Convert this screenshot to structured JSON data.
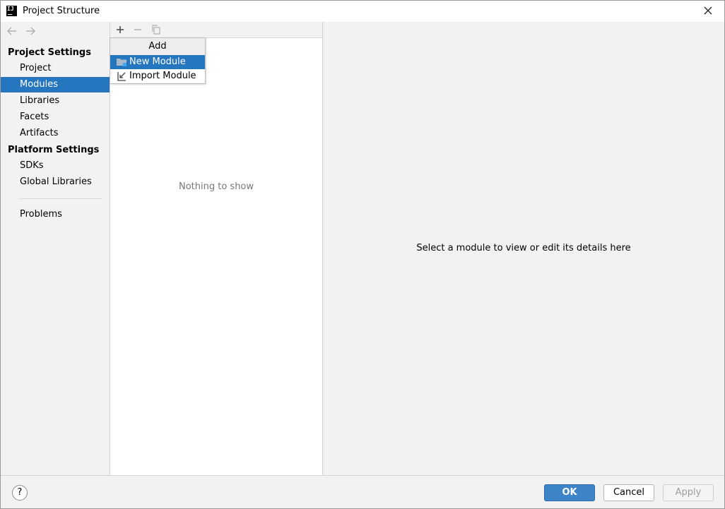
{
  "window": {
    "title": "Project Structure",
    "logo_text": "IJ"
  },
  "sidebar": {
    "project_settings_heading": "Project Settings",
    "project_items": [
      {
        "label": "Project",
        "selected": false
      },
      {
        "label": "Modules",
        "selected": true
      },
      {
        "label": "Libraries",
        "selected": false
      },
      {
        "label": "Facets",
        "selected": false
      },
      {
        "label": "Artifacts",
        "selected": false
      }
    ],
    "platform_settings_heading": "Platform Settings",
    "platform_items": [
      {
        "label": "SDKs"
      },
      {
        "label": "Global Libraries"
      }
    ],
    "problems_label": "Problems"
  },
  "list_pane": {
    "empty_text": "Nothing to show"
  },
  "add_popup": {
    "title": "Add",
    "items": [
      {
        "label": "New Module",
        "icon": "folder-module-icon",
        "selected": true
      },
      {
        "label": "Import Module",
        "icon": "import-module-icon",
        "selected": false
      }
    ]
  },
  "detail_pane": {
    "placeholder": "Select a module to view or edit its details here"
  },
  "footer": {
    "help_label": "?",
    "ok_label": "OK",
    "cancel_label": "Cancel",
    "apply_label": "Apply"
  },
  "colors": {
    "selection": "#2675bf",
    "ok_button": "#3d85c6",
    "panel_bg": "#f2f2f2"
  }
}
